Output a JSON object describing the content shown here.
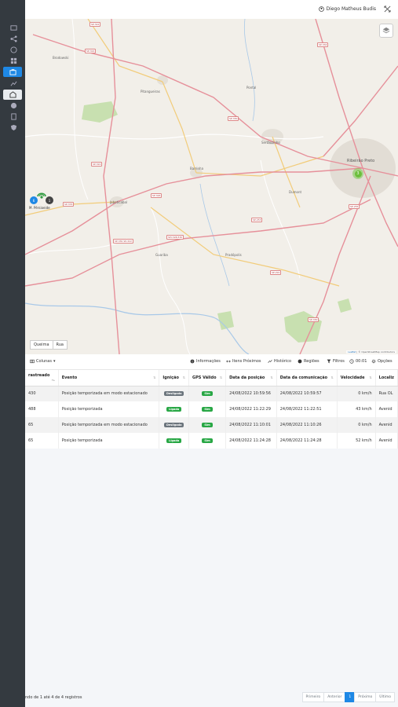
{
  "header": {
    "user_name": "Diego Matheus Budis"
  },
  "map": {
    "places": [
      "Brodowski",
      "Morro Agudo",
      "Pitangueiras",
      "Pontal",
      "Sertãozinho",
      "Ribeirão Preto",
      "Barrinha",
      "Jaboticabal",
      "Dumont",
      "Guariba",
      "Pradópolis"
    ],
    "shields": [
      "SP-322",
      "SP-322",
      "SP-330",
      "SP-334",
      "SP-322",
      "SP-326",
      "SP-333",
      "SP-255",
      "SP-253",
      "SP-291",
      "SP-330 SP-322",
      "SPI-328/330",
      "SP-330"
    ],
    "marker_label": "M. Pérsioeide",
    "cluster_main": "3",
    "cluster_small_a": "6",
    "cluster_small_b": "1",
    "tabs": [
      "Queima",
      "Rua"
    ],
    "attribution_link": "Leaflet",
    "attribution_text": "| © OpenStreetMap contributors"
  },
  "toolbar": {
    "columns": "Colunas",
    "info": "Informações",
    "nearby": "Itens Próximos",
    "history": "Histórico",
    "regions": "Regiões",
    "filters": "Filtros",
    "time": "00:01",
    "options": "Opções"
  },
  "table": {
    "columns": [
      "rastreado",
      "Evento",
      "Ignição",
      "GPS Válido",
      "Data da posição",
      "Data da comunicação",
      "Velocidade",
      "Localiz"
    ],
    "rows": [
      [
        "430",
        "Posição temporizada em modo estacionado",
        "Desligada",
        "Sim",
        "24/08/2022 10:59:56",
        "24/08/2022 10:59:57",
        "0 km/h",
        "Rua OL"
      ],
      [
        "488",
        "Posição temporizada",
        "Ligada",
        "Sim",
        "24/08/2022 11:22:29",
        "24/08/2022 11:22:51",
        "43 km/h",
        "Avenid"
      ],
      [
        "65",
        "Posição temporizada em modo estacionado",
        "Desligada",
        "Sim",
        "24/08/2022 11:10:01",
        "24/08/2022 11:10:26",
        "0 km/h",
        "Avenid"
      ],
      [
        "65",
        "Posição temporizada",
        "Ligada",
        "Sim",
        "24/08/2022 11:24:28",
        "24/08/2022 11:24:28",
        "52 km/h",
        "Avenid"
      ]
    ]
  },
  "footer": {
    "summary": "ndo de 1 até 4 de 4 registros",
    "pages": [
      "Primeiro",
      "Anterior",
      "1",
      "Próximo",
      "Último"
    ]
  },
  "colors": {
    "accent": "#1e88e5",
    "sidebar": "#343a40",
    "badge_green": "#28a745",
    "badge_gray": "#6c757d"
  },
  "icons": [
    "folders-icon",
    "share-icon",
    "globe-icon",
    "grid-icon",
    "briefcase-icon",
    "route-icon",
    "building-icon",
    "globe-alt-icon",
    "document-icon",
    "shield-icon"
  ]
}
